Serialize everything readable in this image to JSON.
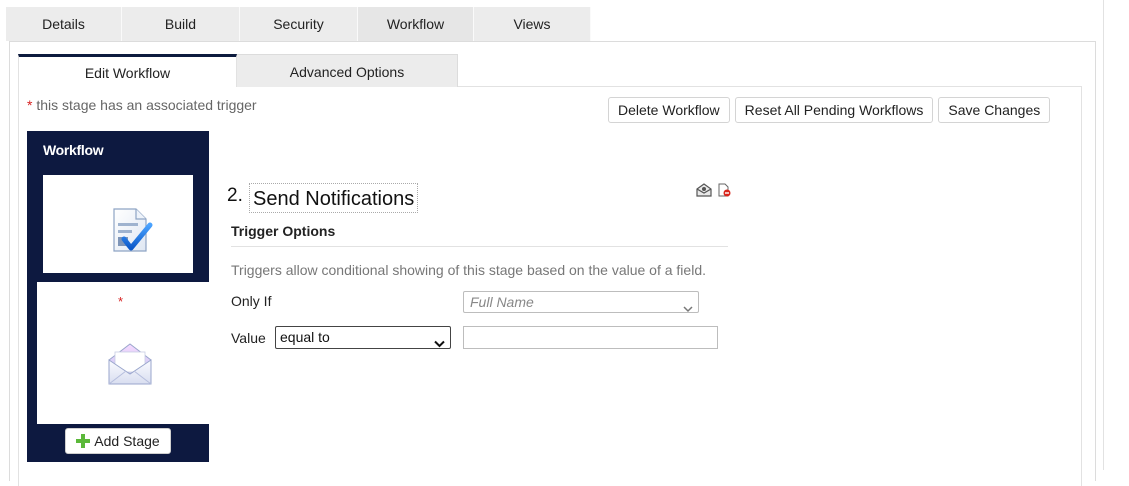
{
  "top_tabs": [
    {
      "label": "Details"
    },
    {
      "label": "Build"
    },
    {
      "label": "Security"
    },
    {
      "label": "Workflow",
      "active": true
    },
    {
      "label": "Views"
    }
  ],
  "sub_tabs": [
    {
      "label": "Edit Workflow",
      "active": true
    },
    {
      "label": "Advanced Options"
    }
  ],
  "trigger_note": {
    "asterisk": "*",
    "text": " this stage has an associated trigger"
  },
  "actions": {
    "delete_label": "Delete Workflow",
    "reset_label": "Reset All Pending Workflows",
    "save_label": "Save Changes"
  },
  "sidebar": {
    "title": "Workflow",
    "stages": [
      {
        "icon": "document-check-icon",
        "has_trigger": false
      },
      {
        "icon": "envelope-icon",
        "has_trigger": true,
        "asterisk": "*"
      }
    ],
    "add_stage_label": "Add Stage"
  },
  "stage": {
    "number": "2.",
    "title": "Send Notifications",
    "tools": [
      "email-settings-icon",
      "delete-stage-icon"
    ]
  },
  "trigger_options": {
    "heading": "Trigger Options",
    "description": "Triggers allow conditional showing of this stage based on the value of a field.",
    "only_if_label": "Only If",
    "field_placeholder": "Full Name",
    "value_label": "Value",
    "operator_selected": "equal to",
    "value": ""
  },
  "colors": {
    "sidebar_bg": "#0d1940",
    "active_tab_accent": "#0d1b3e",
    "trigger_asterisk": "#d62020"
  }
}
